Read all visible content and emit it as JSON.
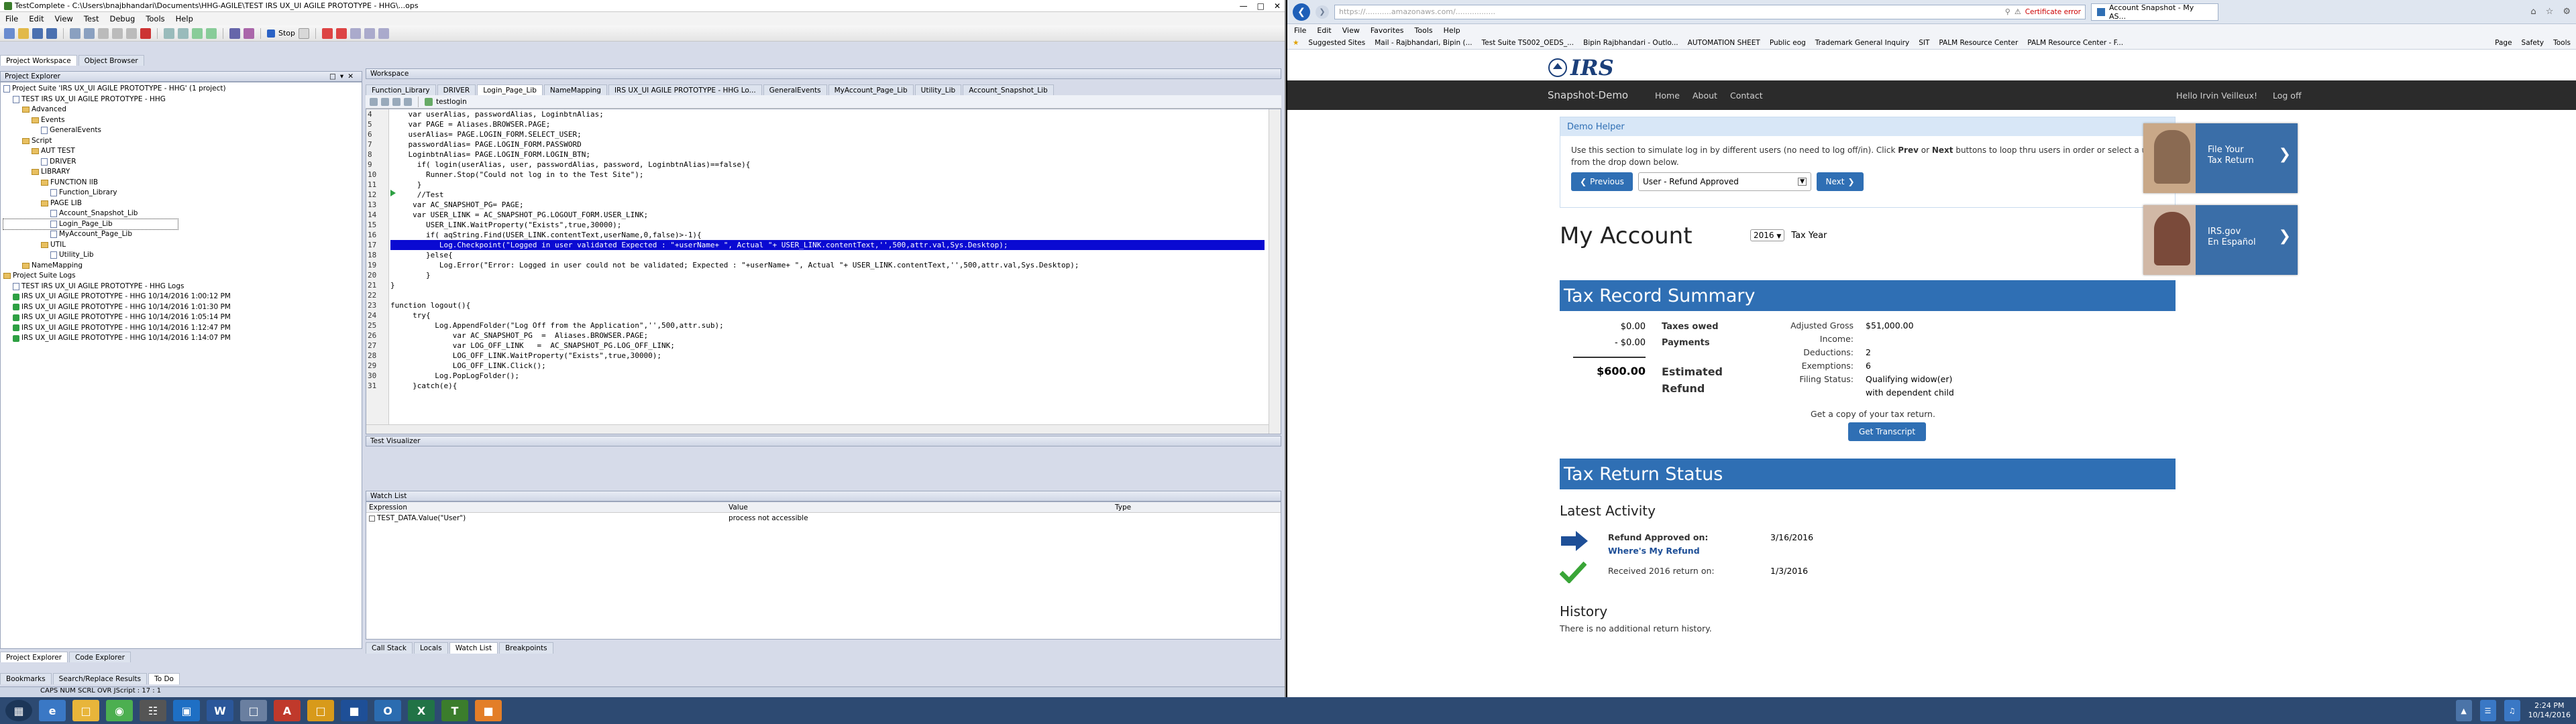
{
  "tc": {
    "title": "TestComplete - C:\\Users\\bnajbhandari\\Documents\\HHG-AGILE\\TEST IRS UX_UI AGILE PROTOTYPE - HHG\\...ops",
    "menu": [
      "File",
      "Edit",
      "View",
      "Test",
      "Debug",
      "Tools",
      "Help"
    ],
    "stop_label": "Stop",
    "left_tabs": [
      "Project Workspace",
      "Object Browser"
    ],
    "explorer_title": "Project Explorer",
    "tree": [
      {
        "label": "Project Suite 'IRS UX_UI AGILE PROTOTYPE - HHG' (1 project)",
        "depth": 0,
        "icon": "project"
      },
      {
        "label": "TEST IRS UX_UI AGILE PROTOTYPE - HHG",
        "depth": 1,
        "icon": "project"
      },
      {
        "label": "Advanced",
        "depth": 2,
        "icon": "folder"
      },
      {
        "label": "Events",
        "depth": 3,
        "icon": "folder"
      },
      {
        "label": "GeneralEvents",
        "depth": 4,
        "icon": "page"
      },
      {
        "label": "Script",
        "depth": 2,
        "icon": "folder"
      },
      {
        "label": "AUT TEST",
        "depth": 3,
        "icon": "folder"
      },
      {
        "label": "DRIVER",
        "depth": 4,
        "icon": "page"
      },
      {
        "label": "LIBRARY",
        "depth": 3,
        "icon": "folder"
      },
      {
        "label": "FUNCTION lIB",
        "depth": 4,
        "icon": "folder"
      },
      {
        "label": "Function_Library",
        "depth": 5,
        "icon": "page"
      },
      {
        "label": "PAGE LIB",
        "depth": 4,
        "icon": "folder"
      },
      {
        "label": "Account_Snapshot_Lib",
        "depth": 5,
        "icon": "page"
      },
      {
        "label": "Login_Page_Lib",
        "depth": 5,
        "icon": "page",
        "selected": true
      },
      {
        "label": "MyAccount_Page_Lib",
        "depth": 5,
        "icon": "page"
      },
      {
        "label": "UTIL",
        "depth": 4,
        "icon": "folder"
      },
      {
        "label": "Utility_Lib",
        "depth": 5,
        "icon": "page"
      },
      {
        "label": "NameMapping",
        "depth": 2,
        "icon": "folder"
      },
      {
        "label": "Project Suite Logs",
        "depth": 0,
        "icon": "folder"
      },
      {
        "label": "TEST IRS UX_UI AGILE PROTOTYPE - HHG Logs",
        "depth": 1,
        "icon": "page"
      },
      {
        "label": "IRS UX_UI AGILE PROTOTYPE - HHG 10/14/2016 1:00:12 PM",
        "depth": 1,
        "icon": "ok"
      },
      {
        "label": "IRS UX_UI AGILE PROTOTYPE - HHG 10/14/2016 1:01:30 PM",
        "depth": 1,
        "icon": "ok"
      },
      {
        "label": "IRS UX_UI AGILE PROTOTYPE - HHG 10/14/2016 1:05:14 PM",
        "depth": 1,
        "icon": "ok"
      },
      {
        "label": "IRS UX_UI AGILE PROTOTYPE - HHG 10/14/2016 1:12:47 PM",
        "depth": 1,
        "icon": "ok"
      },
      {
        "label": "IRS UX_UI AGILE PROTOTYPE - HHG 10/14/2016 1:14:07 PM",
        "depth": 1,
        "icon": "ok"
      }
    ],
    "explorer_bottom_tabs": [
      "Project Explorer",
      "Code Explorer"
    ],
    "workspace_title": "Workspace",
    "editor_tabs": [
      "Function_Library",
      "DRIVER",
      "Login_Page_Lib",
      "NameMapping",
      "IRS UX_UI AGILE PROTOTYPE - HHG Lo...",
      "GeneralEvents",
      "MyAccount_Page_Lib",
      "Utility_Lib",
      "Account_Snapshot_Lib"
    ],
    "active_editor_tab": "Login_Page_Lib",
    "routine": "testlogin",
    "code_lines": [
      {
        "n": "4",
        "t": "    var userAlias, passwordAlias, LoginbtnAlias;"
      },
      {
        "n": "5",
        "t": "    var PAGE = Aliases.BROWSER.PAGE;"
      },
      {
        "n": "6",
        "t": "    userAlias= PAGE.LOGIN_FORM.SELECT_USER;"
      },
      {
        "n": "7",
        "t": "    passwordAlias= PAGE.LOGIN_FORM.PASSWORD"
      },
      {
        "n": "8",
        "t": "    LoginbtnAlias= PAGE.LOGIN_FORM.LOGIN_BTN;"
      },
      {
        "n": "9",
        "t": "      if( login(userAlias, user, passwordAlias, password, LoginbtnAlias)==false){"
      },
      {
        "n": "10",
        "t": "        Runner.Stop(\"Could not log in to the Test Site\");"
      },
      {
        "n": "11",
        "t": "      }"
      },
      {
        "n": "12",
        "t": "      //Test"
      },
      {
        "n": "13",
        "t": "     var AC_SNAPSHOT_PG= PAGE;"
      },
      {
        "n": "14",
        "t": "     var USER_LINK = AC_SNAPSHOT_PG.LOGOUT_FORM.USER_LINK;"
      },
      {
        "n": "15",
        "t": "        USER_LINK.WaitProperty(\"Exists\",true,30000);"
      },
      {
        "n": "16",
        "t": "        if( aqString.Find(USER_LINK.contentText,userName,0,false)>-1){"
      },
      {
        "n": "17",
        "t": "           Log.Checkpoint(\"Logged in user validated Expected : \"+userName+ \", Actual \"+ USER_LINK.contentText,'',500,attr.val,Sys.Desktop);",
        "hl": true
      },
      {
        "n": "18",
        "t": "        }else{"
      },
      {
        "n": "19",
        "t": "           Log.Error(\"Error: Logged in user could not be validated; Expected : \"+userName+ \", Actual \"+ USER_LINK.contentText,'',500,attr.val,Sys.Desktop);"
      },
      {
        "n": "20",
        "t": "        }"
      },
      {
        "n": "21",
        "t": "}"
      },
      {
        "n": "22",
        "t": ""
      },
      {
        "n": "23",
        "t": "function logout(){"
      },
      {
        "n": "24",
        "t": "     try{"
      },
      {
        "n": "25",
        "t": "          Log.AppendFolder(\"Log Off from the Application\",'',500,attr.sub);"
      },
      {
        "n": "26",
        "t": "              var AC_SNAPSHOT_PG  =  Aliases.BROWSER.PAGE;"
      },
      {
        "n": "27",
        "t": "              var LOG_OFF_LINK   =  AC_SNAPSHOT_PG.LOG_OFF_LINK;"
      },
      {
        "n": "28",
        "t": "              LOG_OFF_LINK.WaitProperty(\"Exists\",true,30000);"
      },
      {
        "n": "29",
        "t": "              LOG_OFF_LINK.Click();"
      },
      {
        "n": "30",
        "t": "          Log.PopLogFolder();"
      },
      {
        "n": "31",
        "t": "     }catch(e){"
      }
    ],
    "test_visualizer": "Test Visualizer",
    "watch_title": "Watch List",
    "watch_cols": [
      "Expression",
      "Value",
      "Type"
    ],
    "watch_row": {
      "expr": "TEST_DATA.Value(\"User\")",
      "value": "process not accessible",
      "type": ""
    },
    "debug_tabs": [
      "Call Stack",
      "Locals",
      "Watch List",
      "Breakpoints"
    ],
    "bottom_tabs": [
      "Bookmarks",
      "Search/Replace Results",
      "To Do"
    ],
    "status": "CAPS  NUM  SCRL  OVR    JScript :    17 : 1"
  },
  "browser": {
    "url": "https://...........amazonaws.com/.................",
    "cert_error": "Certificate error",
    "tab_title": "Account Snapshot - My AS...",
    "menu": [
      "File",
      "Edit",
      "View",
      "Favorites",
      "Tools",
      "Help"
    ],
    "favorites": [
      "Suggested Sites",
      "Mail - Rajbhandari, Bipin (...",
      "Test Suite TS002_OEDS_...",
      "Bipin Rajbhandari - Outlo...",
      "AUTOMATION SHEET",
      "Public eog",
      "Trademark General Inquiry",
      "SIT",
      "PALM Resource Center",
      "PALM Resource Center - F..."
    ],
    "cmd_items": [
      "Page",
      "Safety",
      "Tools"
    ]
  },
  "irs": {
    "logo": "IRS",
    "nav": {
      "brand": "Snapshot-Demo",
      "items": [
        "Home",
        "About",
        "Contact"
      ],
      "greeting": "Hello Irvin Veilleux!",
      "logoff": "Log off"
    },
    "helper": {
      "title": "Demo Helper",
      "text_pre": "Use this section to simulate log in by different users (no need to log off/in). Click ",
      "prev_word": "Prev",
      "text_mid": " or ",
      "next_word": "Next",
      "text_post": " buttons to loop thru users in order or select a user from the drop down below.",
      "prev_btn": "Previous",
      "user_select": "User - Refund Approved",
      "next_btn": "Next"
    },
    "account": {
      "title": "My Account",
      "year": "2016",
      "year_label": "Tax Year"
    },
    "summary": {
      "title": "Tax Record Summary",
      "rows": [
        {
          "amount": "$0.00",
          "label": "Taxes owed"
        },
        {
          "amount": "- $0.00",
          "label": "Payments"
        }
      ],
      "total": "$600.00",
      "total_label_1": "Estimated",
      "total_label_2": "Refund",
      "details": [
        {
          "k": "Adjusted Gross",
          "v": "$51,000.00"
        },
        {
          "k": "Income:",
          "v": ""
        },
        {
          "k": "Deductions:",
          "v": "2"
        },
        {
          "k": "Exemptions:",
          "v": "6"
        },
        {
          "k": "Filing Status:",
          "v": "Qualifying widow(er)"
        },
        {
          "k": "",
          "v": "with dependent child"
        }
      ],
      "copy_text": "Get a copy of your tax return.",
      "transcript_btn": "Get Transcript"
    },
    "status": {
      "title": "Tax Return Status",
      "latest": "Latest Activity",
      "items": [
        {
          "label": "Refund Approved on:",
          "date": "3/16/2016",
          "link": "Where's My Refund"
        },
        {
          "label": "Received 2016 return on:",
          "date": "1/3/2016",
          "link": ""
        }
      ]
    },
    "history": {
      "title": "History",
      "text": "There is no additional return history."
    },
    "promos": [
      {
        "line1": "File Your",
        "line2": "Tax Return"
      },
      {
        "line1": "IRS.gov",
        "line2": "En Español"
      }
    ]
  },
  "taskbar": {
    "time": "2:24 PM",
    "date": "10/14/2016"
  }
}
